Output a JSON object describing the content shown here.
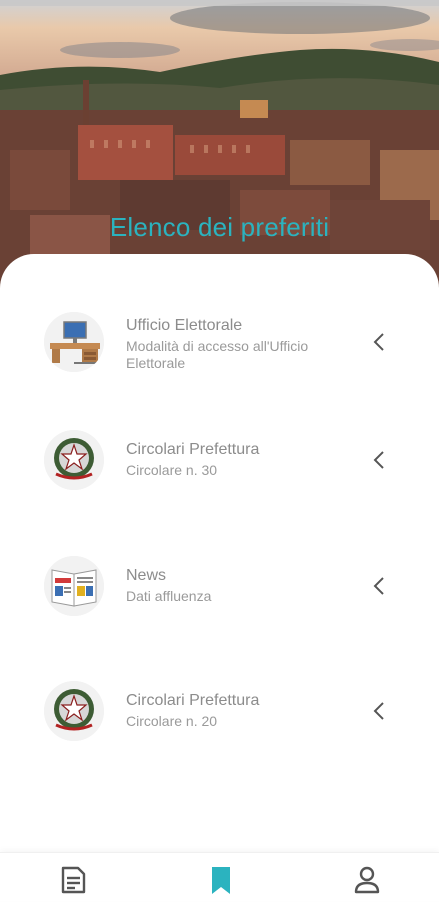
{
  "header": {
    "title": "Elenco dei preferiti"
  },
  "favorites": [
    {
      "title": "Ufficio Elettorale",
      "subtitle": "Modalità di accesso all'Ufficio Elettorale",
      "icon": "office-desk-icon"
    },
    {
      "title": "Circolari Prefettura",
      "subtitle": "Circolare n. 30",
      "icon": "italian-emblem-icon"
    },
    {
      "title": "News",
      "subtitle": "Dati affluenza",
      "icon": "newspaper-icon"
    },
    {
      "title": "Circolari Prefettura",
      "subtitle": "Circolare n. 20",
      "icon": "italian-emblem-icon"
    }
  ],
  "bottom_nav": [
    {
      "name": "documents",
      "icon": "document-list-icon",
      "active": false
    },
    {
      "name": "favorites",
      "icon": "bookmark-icon",
      "active": true
    },
    {
      "name": "profile",
      "icon": "user-icon",
      "active": false
    }
  ],
  "colors": {
    "accent": "#2bb3bf",
    "text_muted": "#8c8c8c",
    "icon_gray": "#555555"
  }
}
